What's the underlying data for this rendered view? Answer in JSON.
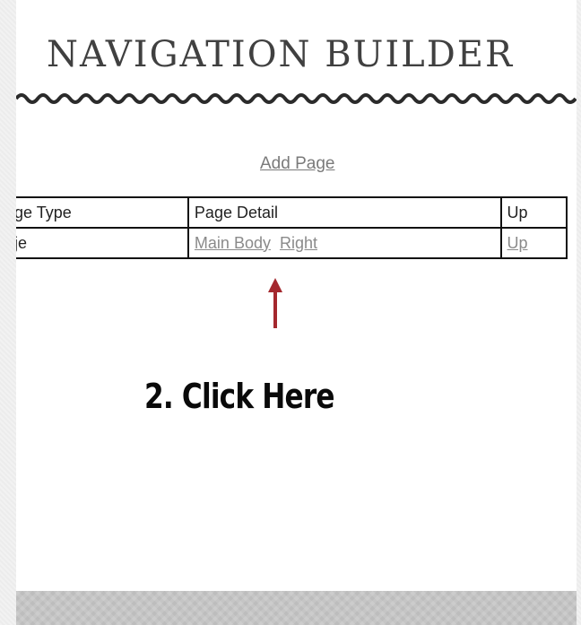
{
  "header": {
    "title": "NAVIGATION BUILDER"
  },
  "actions": {
    "add_page": "Add Page"
  },
  "table": {
    "headers": {
      "type": "ge Type",
      "detail": "Page Detail",
      "update": "Up"
    },
    "row": {
      "type": "je",
      "detail_links": [
        "Main Body",
        "Right"
      ],
      "update_link": "Up"
    }
  },
  "annotation": {
    "callout": "2.  Click Here",
    "arrow_color": "#a4282e"
  },
  "colors": {
    "link": "#8a8a8a",
    "footer": "#bdbdbd",
    "title": "#404040"
  }
}
